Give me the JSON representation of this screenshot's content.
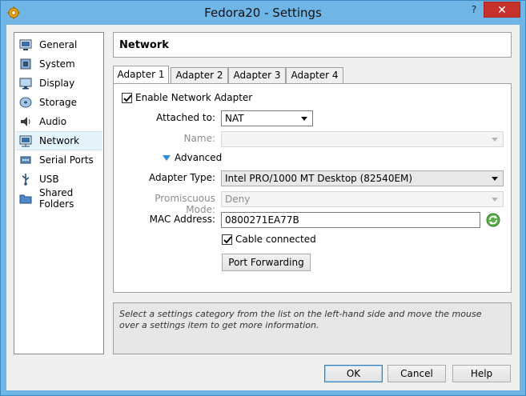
{
  "window": {
    "title": "Fedora20 - Settings",
    "help_glyph": "?",
    "close_glyph": "✕"
  },
  "nav": [
    {
      "label": "General",
      "icon": "general-icon"
    },
    {
      "label": "System",
      "icon": "system-icon"
    },
    {
      "label": "Display",
      "icon": "display-icon"
    },
    {
      "label": "Storage",
      "icon": "storage-icon"
    },
    {
      "label": "Audio",
      "icon": "audio-icon"
    },
    {
      "label": "Network",
      "icon": "network-icon",
      "selected": true
    },
    {
      "label": "Serial Ports",
      "icon": "serial-ports-icon"
    },
    {
      "label": "USB",
      "icon": "usb-icon"
    },
    {
      "label": "Shared Folders",
      "icon": "shared-folders-icon"
    }
  ],
  "section_title": "Network",
  "tabs": [
    {
      "label": "Adapter 1",
      "active": true
    },
    {
      "label": "Adapter 2"
    },
    {
      "label": "Adapter 3"
    },
    {
      "label": "Adapter 4"
    }
  ],
  "adapter": {
    "enable_label": "Enable Network Adapter",
    "enable_checked": true,
    "attached_to_label": "Attached to:",
    "attached_to_value": "NAT",
    "name_label": "Name:",
    "name_value": "",
    "advanced_label": "Advanced",
    "adapter_type_label": "Adapter Type:",
    "adapter_type_value": "Intel PRO/1000 MT Desktop (82540EM)",
    "promiscuous_label": "Promiscuous Mode:",
    "promiscuous_value": "Deny",
    "mac_label": "MAC Address:",
    "mac_value": "0800271EA77B",
    "cable_label": "Cable connected",
    "cable_checked": true,
    "port_forwarding_label": "Port Forwarding"
  },
  "info_text": "Select a settings category from the list on the left-hand side and move the mouse over a settings item to get more information.",
  "buttons": {
    "ok": "OK",
    "cancel": "Cancel",
    "help": "Help"
  },
  "colors": {
    "selection": "#e5f3fb",
    "close": "#c7312b",
    "titlebar": "#6fb5e6"
  }
}
